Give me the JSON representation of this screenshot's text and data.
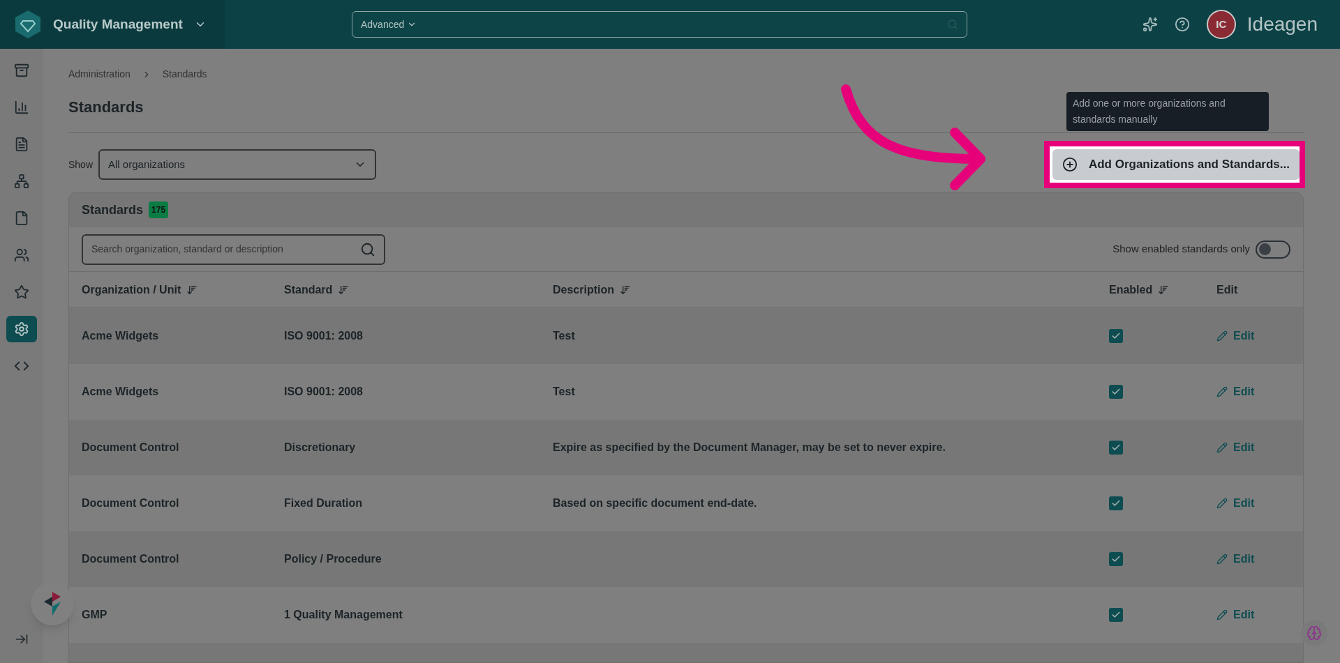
{
  "app": {
    "title": "Quality Management",
    "search_mode": "Advanced",
    "avatar": "IC",
    "brand": "Ideagen"
  },
  "sidebar": {
    "items": [
      {
        "kind": "archive",
        "selected": false
      },
      {
        "kind": "chart",
        "selected": false
      },
      {
        "kind": "document",
        "selected": false
      },
      {
        "kind": "hierarchy",
        "selected": false
      },
      {
        "kind": "file",
        "selected": false
      },
      {
        "kind": "people",
        "selected": false
      },
      {
        "kind": "star",
        "selected": false
      },
      {
        "kind": "settings",
        "selected": true
      },
      {
        "kind": "code",
        "selected": false
      }
    ]
  },
  "breadcrumb": [
    "Administration",
    "Standards"
  ],
  "page_title": "Standards",
  "filter": {
    "label": "Show",
    "value": "All organizations"
  },
  "add_button": {
    "label": "Add Organizations and Standards...",
    "tooltip": "Add one or more organizations and standards manually"
  },
  "card": {
    "title": "Standards",
    "count": "175",
    "search_placeholder": "Search organization, standard or description",
    "toggle": {
      "label": "Show enabled standards only",
      "on": false
    }
  },
  "table": {
    "columns": [
      {
        "label": "Organization / Unit",
        "sortable": true
      },
      {
        "label": "Standard",
        "sortable": true
      },
      {
        "label": "Description",
        "sortable": true
      },
      {
        "label": "Enabled",
        "sortable": true
      },
      {
        "label": "Edit",
        "sortable": false
      }
    ],
    "rows": [
      {
        "organization": "Acme Widgets",
        "standard": "ISO 9001: 2008",
        "description": "Test",
        "enabled": true,
        "action": "Edit"
      },
      {
        "organization": "Acme Widgets",
        "standard": "ISO 9001: 2008",
        "description": "Test",
        "enabled": true,
        "action": "Edit"
      },
      {
        "organization": "Document Control",
        "standard": "Discretionary",
        "description": "Expire as specified by the Document Manager, may be set to never expire.",
        "enabled": true,
        "action": "Edit"
      },
      {
        "organization": "Document Control",
        "standard": "Fixed Duration",
        "description": "Based on specific document end-date.",
        "enabled": true,
        "action": "Edit"
      },
      {
        "organization": "Document Control",
        "standard": "Policy / Procedure",
        "description": "",
        "enabled": true,
        "action": "Edit"
      },
      {
        "organization": "GMP",
        "standard": "1 Quality Management",
        "description": "",
        "enabled": true,
        "action": "Edit"
      }
    ]
  }
}
